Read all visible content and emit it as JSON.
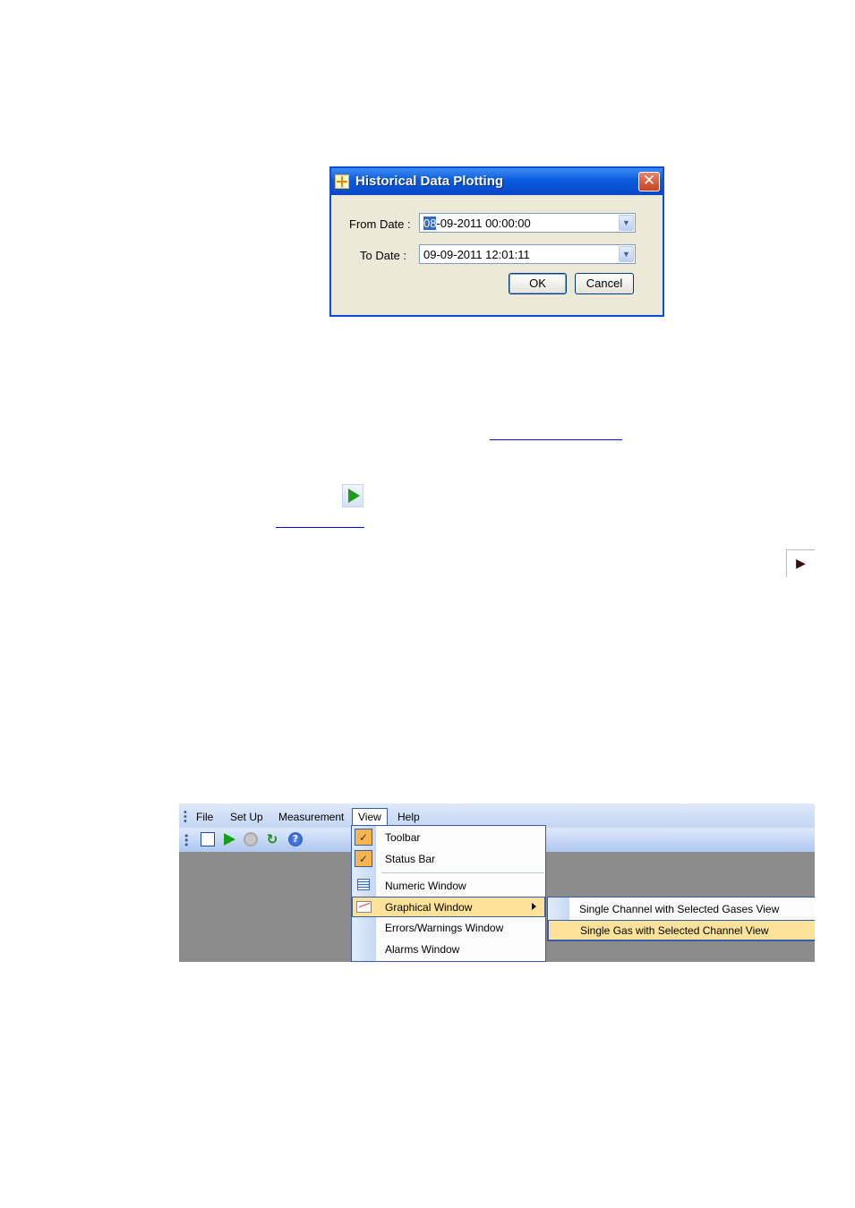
{
  "dialog": {
    "title": "Historical Data Plotting",
    "from_label": "From Date :",
    "from_value_selected": "08",
    "from_value_rest": "-09-2011 00:00:00",
    "to_label": "To Date :",
    "to_value": "09-09-2011 12:01:11",
    "ok_label": "OK",
    "cancel_label": "Cancel"
  },
  "app": {
    "menus": [
      "File",
      "Set Up",
      "Measurement",
      "View",
      "Help"
    ],
    "toolbar_icons": [
      "new-document-icon",
      "start-play-icon",
      "stop-icon",
      "refresh-icon",
      "help-icon"
    ],
    "view_menu": {
      "items": [
        "Toolbar",
        "Status Bar",
        "Numeric Window",
        "Graphical Window",
        "Errors/Warnings Window",
        "Alarms Window"
      ],
      "checked": [
        "Toolbar",
        "Status Bar"
      ],
      "highlighted": "Graphical Window"
    },
    "graphical_submenu": {
      "items": [
        "Single Channel with Selected Gases View",
        "Single Gas with Selected Channel View"
      ],
      "highlighted": "Single Gas with Selected Channel View"
    }
  },
  "colors": {
    "title_bar": "#0b5be0",
    "highlight": "#fde39a",
    "check_bg": "#f7b54b",
    "menubar": "#c4d7f5"
  }
}
